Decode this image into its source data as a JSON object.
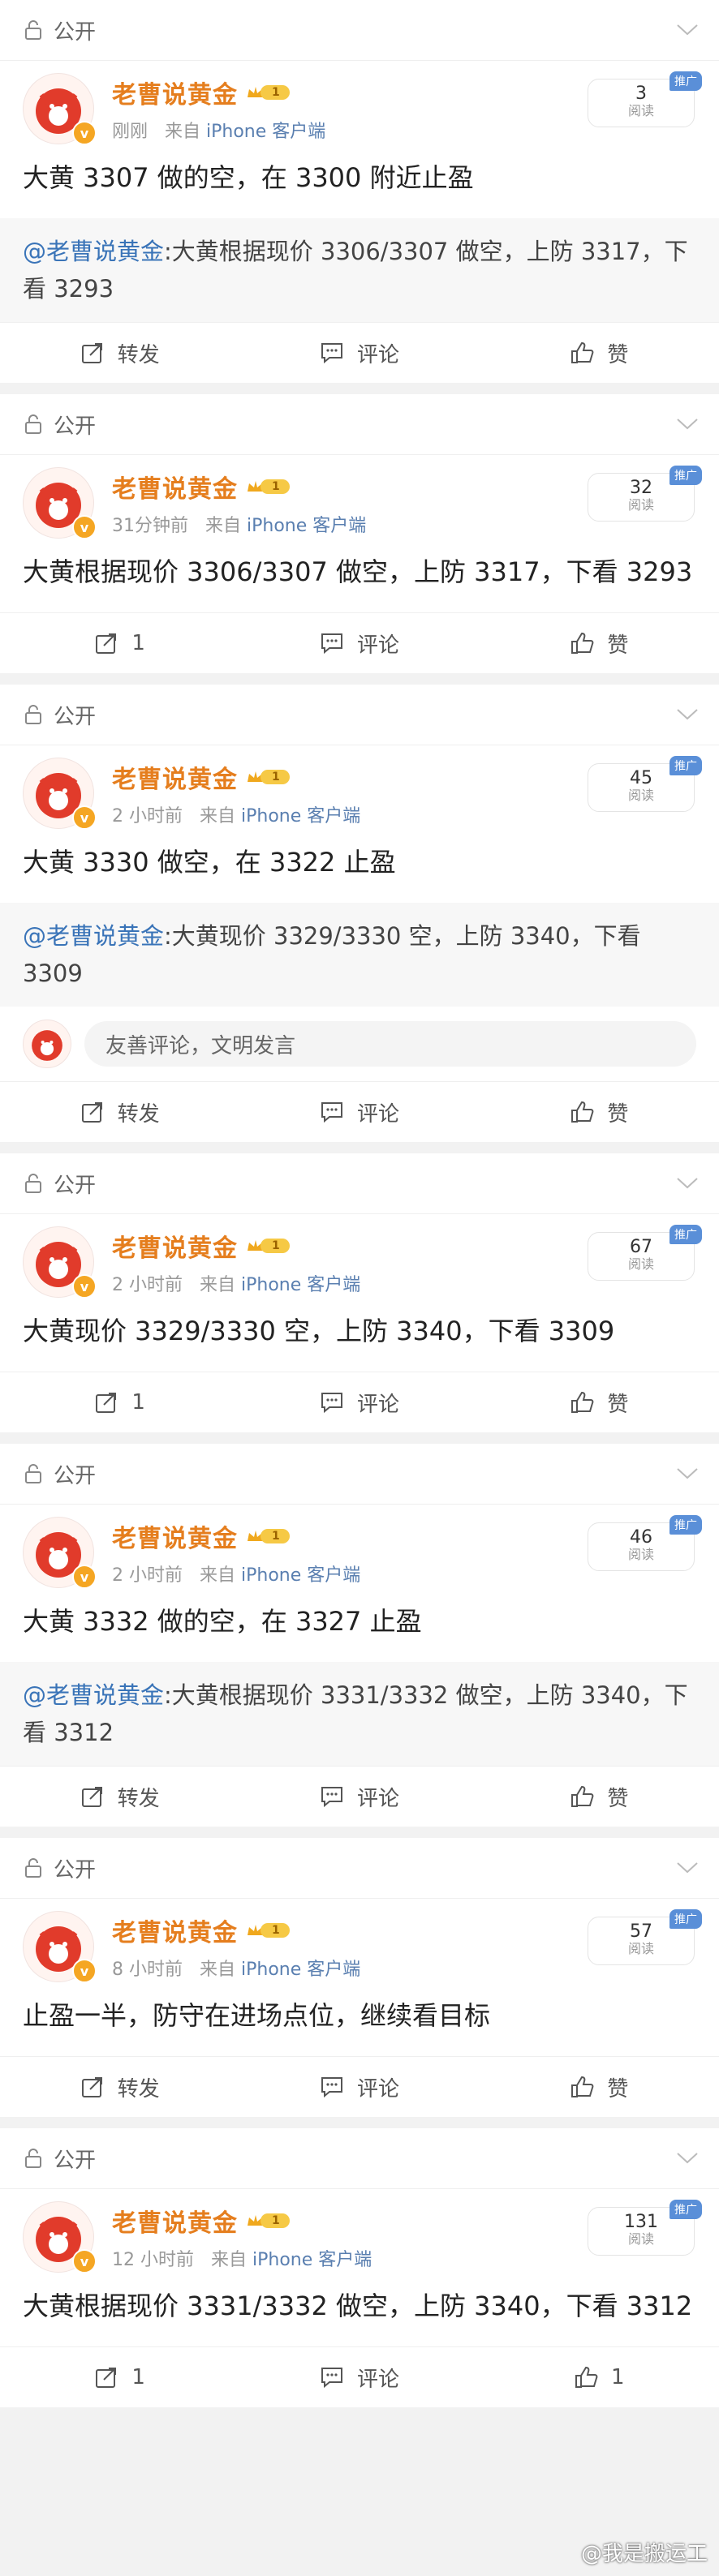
{
  "colors": {
    "name": "#e57e1e",
    "link": "#3a74b8",
    "badge": "#5a8fd8"
  },
  "common": {
    "visibility": "公开",
    "author": "老曹说黄金",
    "level": "1",
    "source_prefix": "来自",
    "source": "iPhone 客户端",
    "reads_label": "阅读",
    "promo": "推广",
    "forward": "转发",
    "comment": "评论",
    "like": "赞",
    "comment_placeholder": "友善评论，文明发言"
  },
  "posts": [
    {
      "time": "刚刚",
      "reads": "3",
      "text": "大黄 3307 做的空，在 3300 附近止盈",
      "quote_author": "@老曹说黄金",
      "quote_text": ":大黄根据现价 3306/3307 做空，上防 3317，下看 3293",
      "forward": "转发"
    },
    {
      "time": "31分钟前",
      "reads": "32",
      "text": "大黄根据现价 3306/3307 做空，上防 3317，下看 3293",
      "forward": "1"
    },
    {
      "time": "2 小时前",
      "reads": "45",
      "text": "大黄 3330 做空，在 3322 止盈",
      "quote_author": "@老曹说黄金",
      "quote_text": ":大黄现价 3329/3330 空，上防 3340，下看 3309",
      "forward": "转发"
    },
    {
      "time": "2 小时前",
      "reads": "67",
      "text": "大黄现价 3329/3330 空，上防 3340，下看 3309",
      "forward": "1"
    },
    {
      "time": "2 小时前",
      "reads": "46",
      "text": "大黄 3332 做的空，在 3327 止盈",
      "quote_author": "@老曹说黄金",
      "quote_text": ":大黄根据现价 3331/3332 做空，上防 3340，下看 3312",
      "forward": "转发"
    },
    {
      "time": "8 小时前",
      "reads": "57",
      "text": "止盈一半，防守在进场点位，继续看目标",
      "forward": "转发"
    },
    {
      "time": "12 小时前",
      "reads": "131",
      "text": "大黄根据现价 3331/3332 做空，上防 3340，下看 3312",
      "forward": "1",
      "like": "1"
    }
  ],
  "watermark": "@我是搬运工"
}
